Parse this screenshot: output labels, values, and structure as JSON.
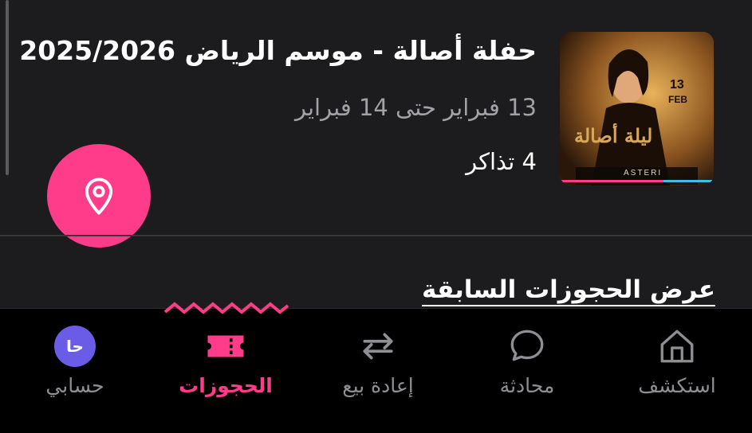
{
  "booking": {
    "title": "حفلة أصالة - موسم الرياض 2025/2026",
    "dates": "13 فبراير  حتى 14 فبراير",
    "tickets": "4 تذاكر",
    "poster": {
      "date_badge_day": "13",
      "date_badge_month": "FEB",
      "calligraphy": "ليلة أصالة",
      "sponsor": "ASTERI"
    }
  },
  "location_button": {
    "icon": "map-pin-icon"
  },
  "past_bookings_link": "عرض الحجوزات السابقة",
  "tab_bar": {
    "explore_label": "استكشف",
    "chat_label": "محادثة",
    "resale_label": "إعادة بيع",
    "bookings_label": "الحجوزات",
    "account_label": "حسابي",
    "avatar_initials": "حا",
    "active_tab": "bookings"
  },
  "colors": {
    "accent": "#ff3c8a",
    "background": "#1c1c1e",
    "tab_bar_background": "#000000",
    "muted_text": "#a1a1a6",
    "inactive_tab": "#8e8e93",
    "avatar": "#6b5ce7"
  }
}
